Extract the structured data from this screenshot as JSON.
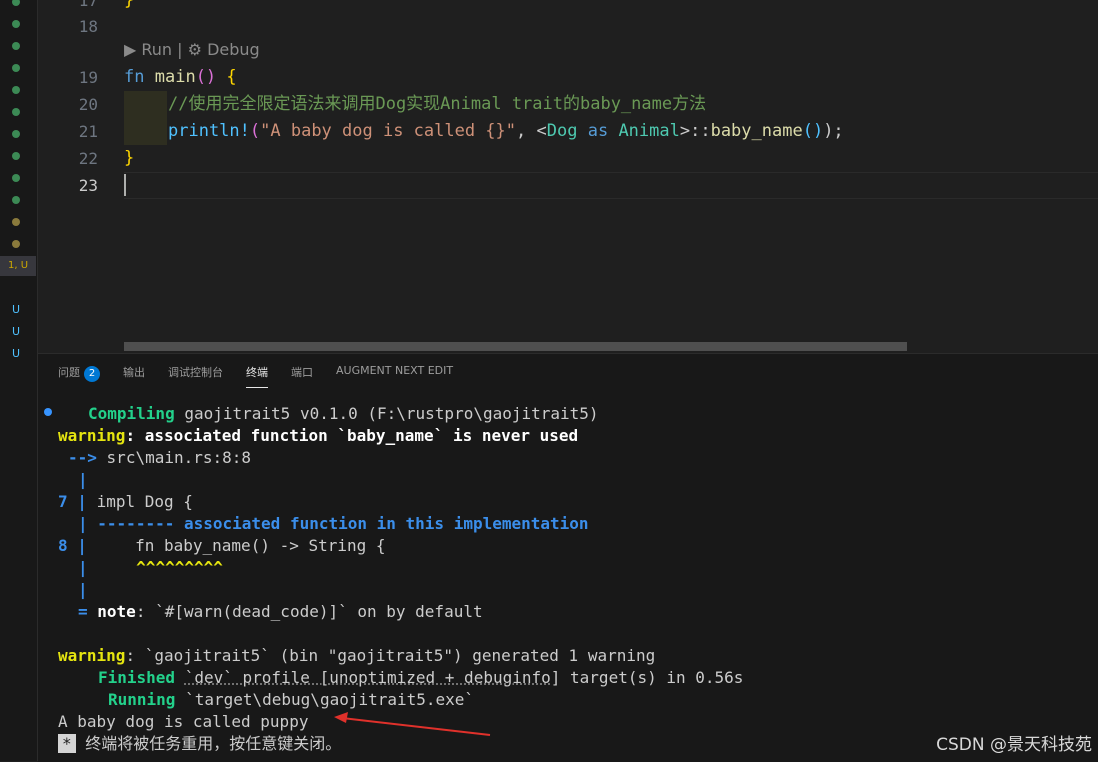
{
  "editor": {
    "codelens": "▶ Run | ⚙ Debug",
    "line_numbers": [
      "17",
      "18",
      "19",
      "20",
      "21",
      "22",
      "23"
    ],
    "lines": {
      "l17": "}",
      "l19_kw": "fn",
      "l19_name": "main",
      "l19_paren": "()",
      "l19_brace": "{",
      "l20_comment": "//使用完全限定语法来调用Dog实现Animal trait的baby_name方法",
      "l21_macro": "println!",
      "l21_paren_open": "(",
      "l21_string": "\"A baby dog is called {}\"",
      "l21_comma": ", <",
      "l21_type1": "Dog",
      "l21_as": "as",
      "l21_type2": "Animal",
      "l21_sep": ">::",
      "l21_fn": "baby_name",
      "l21_call": "()",
      "l21_end": ");",
      "l22": "}"
    }
  },
  "gutter": {
    "badge": "1, U",
    "markers": [
      "U",
      "U",
      "U"
    ]
  },
  "panel": {
    "tabs": [
      {
        "label": "问题",
        "count": "2"
      },
      {
        "label": "输出"
      },
      {
        "label": "调试控制台"
      },
      {
        "label": "终端"
      },
      {
        "label": "端口"
      },
      {
        "label": "AUGMENT NEXT EDIT"
      }
    ],
    "active_tab": "终端"
  },
  "terminal": {
    "compiling_label": "Compiling",
    "compiling_text": "gaojitrait5 v0.1.0 (F:\\rustpro\\gaojitrait5)",
    "warning_label": "warning",
    "warning_text": ": associated function `baby_name` is never used",
    "arrow": "-->",
    "location": "src\\main.rs:8:8",
    "pipe": "|",
    "ln7": "7",
    "code7": "impl Dog {",
    "dashes": "-------- associated function in this implementation",
    "ln8": "8",
    "code8": "    fn baby_name() -> String {",
    "carets": "    ^^^^^^^^^",
    "note_eq": "=",
    "note_label": "note",
    "note_text": ": `#[warn(dead_code)]` on by default",
    "warning2_label": "warning",
    "warning2_text": ": `gaojitrait5` (bin \"gaojitrait5\") generated 1 warning",
    "finished_label": "Finished",
    "finished_profile": "`dev` profile [unoptimized + debuginfo]",
    "finished_text": "target(s) in 0.56s",
    "running_label": "Running",
    "running_text": "`target\\debug\\gaojitrait5.exe`",
    "output": "A baby dog is called puppy",
    "star": "*",
    "reuse_msg": "终端将被任务重用，按任意键关闭。"
  },
  "watermark": "CSDN @景天科技苑",
  "colors": {
    "accent": "#0078d4",
    "annotation_arrow": "#e0312b"
  }
}
